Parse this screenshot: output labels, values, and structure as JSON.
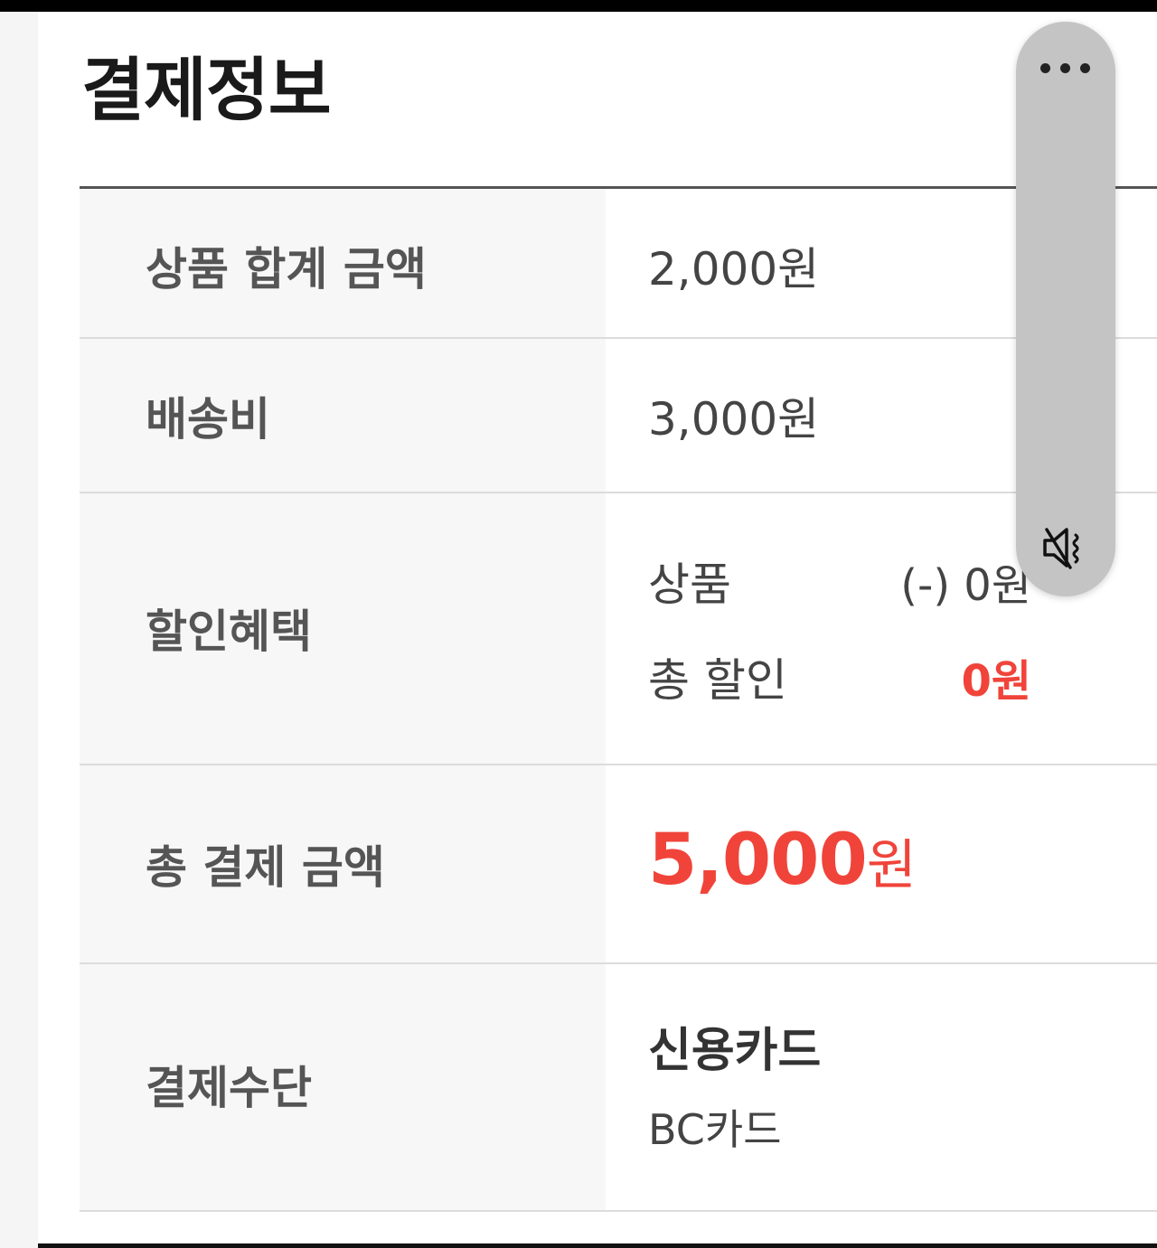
{
  "page": {
    "title": "결제정보"
  },
  "rows": {
    "subtotal": {
      "label": "상품 합계 금액",
      "value": "2,000원"
    },
    "shipping": {
      "label": "배송비",
      "value": "3,000원"
    },
    "discount": {
      "label": "할인혜택",
      "product_label": "상품",
      "product_amount": "(-) 0원",
      "total_label": "총 할인",
      "total_amount": "0원"
    },
    "total": {
      "label": "총 결제 금액",
      "amount": "5,000",
      "unit": "원"
    },
    "payment_method": {
      "label": "결제수단",
      "method": "신용카드",
      "card": "BC카드"
    }
  },
  "floating_controls": {
    "more_icon": "more-horizontal-icon",
    "mute_icon": "speaker-muted-icon"
  },
  "colors": {
    "accent_red": "#f0443a",
    "label_text": "#555555",
    "label_bg": "#f7f7f7"
  }
}
